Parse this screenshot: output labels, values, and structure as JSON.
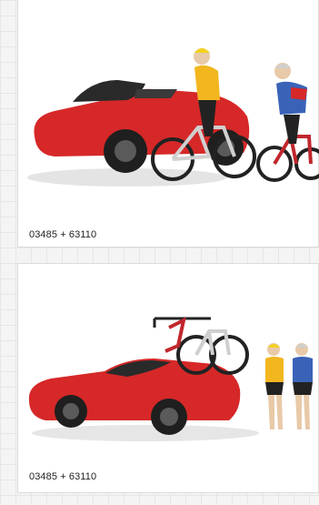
{
  "products": [
    {
      "caption": "03485 + 63110",
      "image_icon": "red-roadster-with-two-cyclists-icon"
    },
    {
      "caption": "03485 + 63110",
      "image_icon": "red-roadster-with-roof-bike-rack-icon"
    }
  ],
  "colors": {
    "car_red": "#d62828",
    "car_dark": "#1f1f1f",
    "jersey_yellow": "#f2b61f",
    "jersey_blue": "#3a63b8",
    "card_border": "#dcdcdc"
  }
}
